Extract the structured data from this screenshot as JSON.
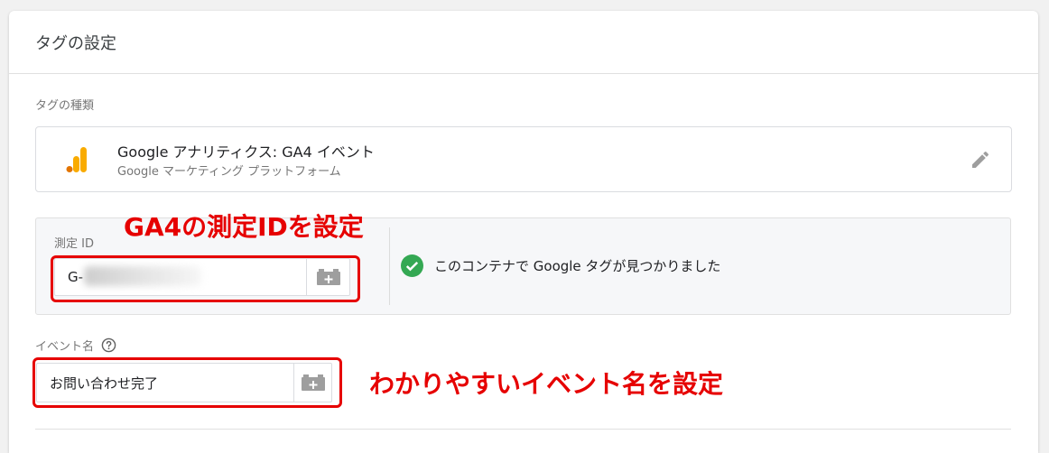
{
  "card": {
    "title": "タグの設定"
  },
  "tag_type": {
    "label": "タグの種類",
    "name": "Google アナリティクス: GA4 イベント",
    "subtitle": "Google マーケティング プラットフォーム",
    "icon": "google-analytics-icon"
  },
  "measurement": {
    "label": "測定 ID",
    "value": "G-",
    "status": "このコンテナで Google タグが見つかりました",
    "status_color": "#34a853"
  },
  "event": {
    "label": "イベント名",
    "value": "お問い合わせ完了"
  },
  "annotations": {
    "measurement_note": "GA4の測定IDを設定",
    "event_note": "わかりやすいイベント名を設定",
    "color": "#e60000"
  },
  "colors": {
    "ga_orange": "#f9ab00",
    "ga_dark_orange": "#e37400",
    "icon_gray": "#9e9e9e"
  }
}
